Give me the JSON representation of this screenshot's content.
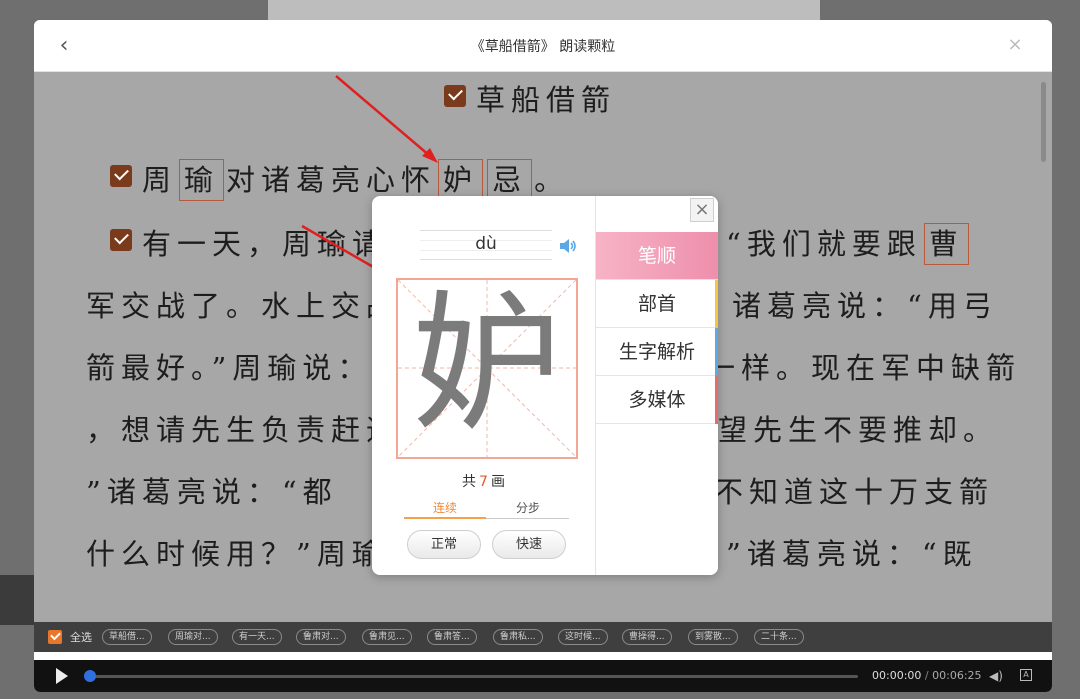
{
  "window": {
    "title": "《草船借箭》 朗读颗粒",
    "back_glyph": "‹",
    "close_glyph": "×"
  },
  "reader": {
    "title": "草船借箭",
    "lines": [
      {
        "pre": "周",
        "hl1": "瑜",
        "mid": "对诸葛亮心怀",
        "hl2": "妒",
        "hl3": "忌",
        "post": "。"
      },
      {
        "text": "有一天，周瑜请",
        "right": "“我们就要跟",
        "right_hl": "曹"
      },
      {
        "left": "军交战了。水上交战",
        "right": "诸葛亮说：“用弓"
      },
      {
        "left": "箭最好。”周瑜说：",
        "right": "一样。现在军中缺箭"
      },
      {
        "left": "，想请先生负责赶造",
        "right": "望先生不要推却。"
      },
      {
        "left": "”诸葛亮说：“都",
        "right": "不知道这十万支箭"
      },
      {
        "left": "什么时候用？”周瑜",
        "right": "”诸葛亮说：“既"
      }
    ]
  },
  "popup": {
    "pinyin": "dù",
    "character": "妒",
    "stroke_prefix": "共",
    "stroke_count": "7",
    "stroke_suffix": "画",
    "modes": [
      "连续",
      "分步"
    ],
    "speeds": [
      "正常",
      "快速"
    ],
    "menu": [
      "笔顺",
      "部首",
      "生字解析",
      "多媒体"
    ],
    "close_glyph": "×"
  },
  "chips": {
    "all_label": "全选",
    "items": [
      "草船借...",
      "周瑜对...",
      "有一天...",
      "鲁肃对...",
      "鲁肃见...",
      "鲁肃答...",
      "鲁肃私...",
      "这时候...",
      "曹操得...",
      "到雾散...",
      "二十条..."
    ]
  },
  "player": {
    "current": "00:00:00",
    "separator": "/",
    "total": "00:06:25",
    "progress": 0.0,
    "subtitle_glyph": "A"
  },
  "colors": {
    "accent_pink": "#ee8fac",
    "checkbox_brown": "#7a3a1c",
    "highlight_border": "#b85a3a",
    "stroke_count": "#e8552a",
    "progress_blue": "#2f6fe0",
    "side_tabs": [
      "#f7b3c6",
      "#f5c542",
      "#5aa9e6",
      "#e86a6a"
    ]
  }
}
